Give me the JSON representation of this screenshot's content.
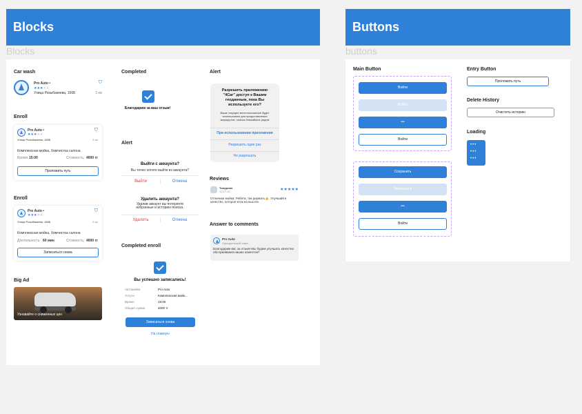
{
  "blocks_frame": {
    "header": "Blocks",
    "caption": "Blocks"
  },
  "buttons_frame": {
    "header": "Buttons",
    "caption": "buttons"
  },
  "car_wash": {
    "section": "Car wash",
    "name": "Pro Auto •",
    "address": "Улица Розыбакиева, 166Б",
    "distance": "3 км"
  },
  "enroll1": {
    "section": "Enroll",
    "name": "Pro Auto •",
    "address": "Улица Розыбакиева, 166Б",
    "distance": "3 км",
    "service": "Комплексная мойка, Химчистка салона",
    "time_label": "Время:",
    "time_value": "15:00",
    "cost_label": "Стоимость:",
    "cost_value": "4000 тг",
    "button": "Проложить путь"
  },
  "enroll2": {
    "section": "Enroll",
    "name": "Pro Auto •",
    "address": "Улица Розыбакиева, 166Б",
    "distance": "3 км",
    "service": "Комплексная мойка, Химчистка салона",
    "duration_label": "Длительность:",
    "duration_value": "60 мин",
    "cost_label": "Стоимость:",
    "cost_value": "4000 тг",
    "button": "Записаться снова"
  },
  "big_ad": {
    "section": "Big Ad",
    "text": "Узнавайте о сниженных цен"
  },
  "completed": {
    "section": "Completed",
    "text": "Благодарим за ваш отзыв!"
  },
  "alert_mid": {
    "section": "Alert",
    "a1_title": "Выйти с аккаунта?",
    "a1_text": "Вы точно хотите выйти из аккаунта?",
    "a1_left": "Выйти",
    "a1_right": "Отмена",
    "a2_title": "Удалить аккаунта?",
    "a2_text": "Удалив аккаунт вы потеряете избранные и историю поиска.",
    "a2_left": "Удалить",
    "a2_right": "Отмена"
  },
  "completed_enroll": {
    "section": "Completed enroll",
    "title": "Вы успешно записались!",
    "rows": [
      {
        "k": "Автомойка",
        "v": "Pro Auto"
      },
      {
        "k": "Услуги",
        "v": "Комплексная мойк..."
      },
      {
        "k": "Время",
        "v": "15:00"
      },
      {
        "k": "Общая сумма",
        "v": "4000 тг"
      }
    ],
    "primary": "Записаться снова",
    "link": "На главную"
  },
  "alert_right": {
    "section": "Alert",
    "title": "Разрешить приложению \"4Car\" доступ к Вашим геоданным, пока Вы используете его?",
    "text": "Ваше текущее местоположение будет использовано для предоставления маршрутов, поиска ближайших рядом",
    "opt1": "При использовании приложения",
    "opt2": "Разрешить один раз",
    "opt3": "Не разрешать"
  },
  "reviews": {
    "section": "Reviews",
    "name": "Тимурлан",
    "date": "12.07.22",
    "text": "Отличная мойка. Ребята, так держать👍. Улучшайте качество, которое итак на высоте."
  },
  "answer": {
    "section": "Answer to comments",
    "name": "Pro Auto",
    "role": "Официальный ответ",
    "text": "Благодарим вас за отзыв! Мы будем улучшать качество обслуживания наших клиентов?"
  },
  "main_button": {
    "section": "Main Button",
    "g1": [
      "Войти",
      "Войти",
      "•••",
      "Войти"
    ],
    "g2": [
      "Сохранить",
      "Записаться",
      "•••",
      "Войти"
    ]
  },
  "entry_button": {
    "section": "Entry Button",
    "label": "Проложить путь"
  },
  "delete_history": {
    "section": "Delete History",
    "label": "Очистить историю"
  },
  "loading": {
    "section": "Loading",
    "dots": [
      "•••",
      "•••",
      "•••"
    ]
  },
  "colors": {
    "accent": "#2f80d9",
    "danger": "#e0383a",
    "disabled": "#d4e3f3"
  }
}
